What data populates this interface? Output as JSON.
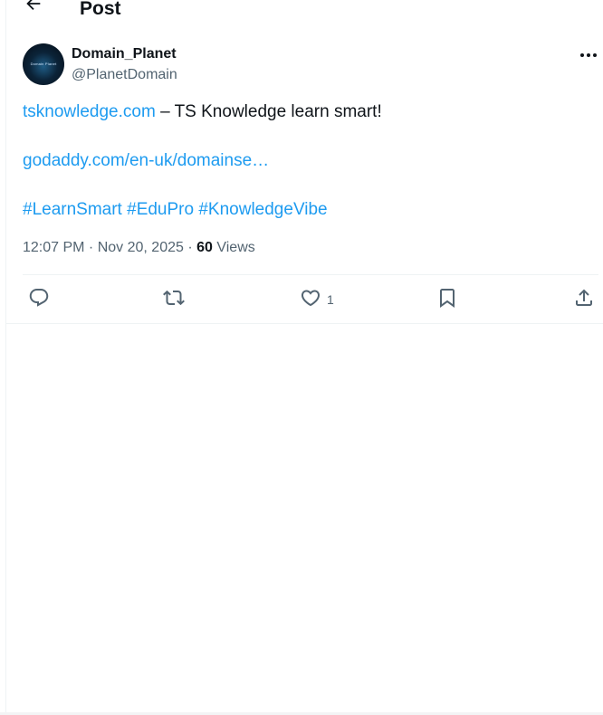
{
  "header": {
    "title": "Post",
    "back_icon": "arrow-left-icon"
  },
  "author": {
    "display_name": "Domain_Planet",
    "handle": "@PlanetDomain",
    "avatar_text": "Domain Planet",
    "more_icon": "more-horizontal-icon"
  },
  "tweet": {
    "link1": "tsknowledge.com",
    "text1": " – TS Knowledge learn smart!",
    "link2": "godaddy.com/en-uk/domainse…",
    "hashtags": [
      "#LearnSmart",
      "#EduPro",
      "#KnowledgeVibe"
    ]
  },
  "meta": {
    "time": "12:07 PM",
    "separator": " · ",
    "date": "Nov 20, 2025",
    "views_count": "60",
    "views_label": " Views"
  },
  "actions": {
    "reply_icon": "reply-icon",
    "repost_icon": "repost-icon",
    "like_icon": "heart-icon",
    "like_count": "1",
    "bookmark_icon": "bookmark-icon",
    "share_icon": "share-icon"
  },
  "colors": {
    "link": "#1d9bf0",
    "text": "#0f1419",
    "secondary": "#536471",
    "border": "#eff3f4"
  }
}
